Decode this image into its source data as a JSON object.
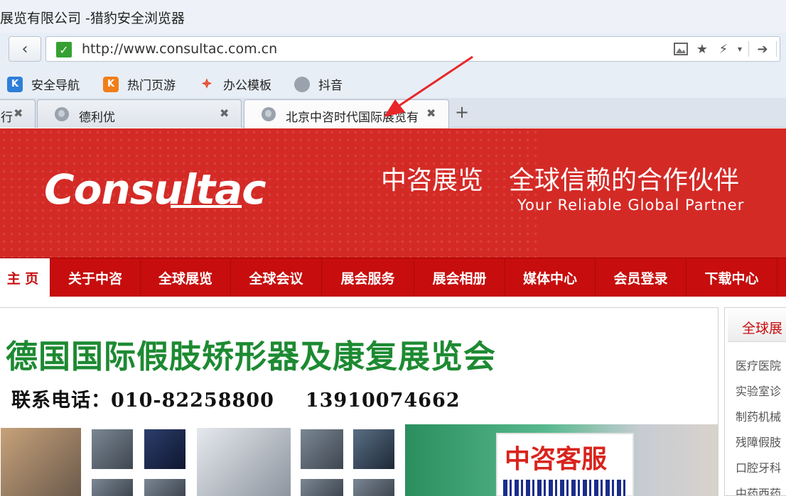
{
  "browser": {
    "window_title": "展览有限公司 -猎豹安全浏览器",
    "address_url": "http://www.consultac.com.cn",
    "bookmarks": [
      {
        "label": "安全导航",
        "icon": "shield-k-icon",
        "color": "#2f7fd8"
      },
      {
        "label": "热门页游",
        "icon": "game-k-icon",
        "color": "#f07e1a"
      },
      {
        "label": "办公模板",
        "icon": "office-template-icon",
        "color": "#e34a2a"
      },
      {
        "label": "抖音",
        "icon": "globe-icon",
        "color": "#9aa3ad"
      }
    ],
    "tabs": [
      {
        "label": "",
        "active": false
      },
      {
        "label": "德利优",
        "active": false
      },
      {
        "label": "北京中咨时代国际展览有",
        "active": true
      }
    ]
  },
  "banner": {
    "logo_text": "Consultac",
    "slogan_cn": "中咨展览　全球信赖的合作伙伴",
    "slogan_en": "Your Reliable Global Partner",
    "color": "#d42a26"
  },
  "nav": {
    "items": [
      {
        "label": "主 页",
        "active": true
      },
      {
        "label": "关于中咨",
        "active": false
      },
      {
        "label": "全球展览",
        "active": false
      },
      {
        "label": "全球会议",
        "active": false
      },
      {
        "label": "展会服务",
        "active": false
      },
      {
        "label": "展会相册",
        "active": false
      },
      {
        "label": "媒体中心",
        "active": false
      },
      {
        "label": "会员登录",
        "active": false
      },
      {
        "label": "下载中心",
        "active": false
      }
    ],
    "color": "#c70d0d"
  },
  "feature": {
    "expo_title": "德国国际假肢矫形器及康复展览会",
    "contact_prefix": "联系电话：",
    "phone_1": "010-82258800",
    "phone_2": "13910074662",
    "customer_service": "中咨客服"
  },
  "sidebar": {
    "heading": "全球展",
    "items": [
      "医疗医院",
      "实验室诊",
      "制药机械",
      "残障假肢",
      "口腔牙科",
      "中药西药"
    ]
  }
}
